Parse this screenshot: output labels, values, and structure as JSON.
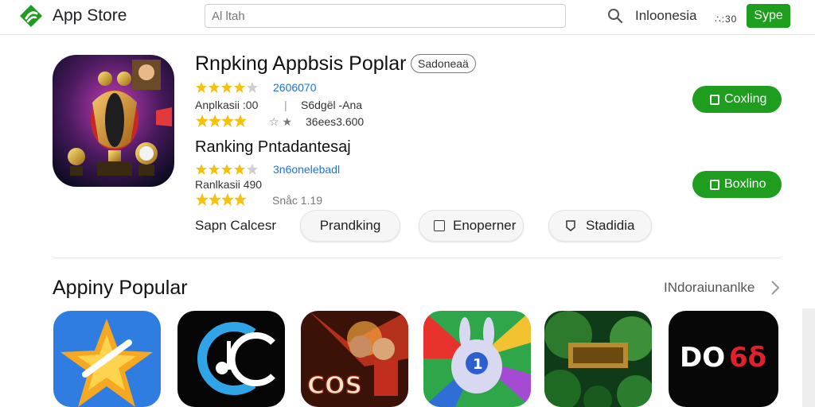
{
  "header": {
    "app_title": "App Store",
    "search_value": "Al ltah",
    "search_meta": "∴:30",
    "region": "Inloonesia",
    "sync_label": "Sype"
  },
  "ranking": {
    "title": "Rnpking Appbsis Poplar",
    "region_chip": "Sadoneaä",
    "item1": {
      "score": "2606070",
      "label": "Anplkasii :00",
      "sublabel": "S6dgël -Ana",
      "count": "36ees3.600",
      "button": "Coxling"
    },
    "subtitle": "Ranking Pntadantesaj",
    "item2": {
      "score": "3n6onelebadl",
      "label": "Ranlkasii 490",
      "count": "Snåc 1.19",
      "button": "Boxlino"
    },
    "filter_label": "Sapn Calcesr",
    "filters": [
      "Prandking",
      "Enoperner",
      "Stadidia"
    ]
  },
  "popular": {
    "title": "Appiny Popular",
    "see_more": "INdoraiunanlke",
    "apps": [
      {
        "name": "star-app",
        "text": ""
      },
      {
        "name": "music-app",
        "text": "C"
      },
      {
        "name": "action-game",
        "text": "COS"
      },
      {
        "name": "rabbit-game",
        "text": "1"
      },
      {
        "name": "jungle-game",
        "text": ""
      },
      {
        "name": "d-app",
        "text": "DO6δ"
      }
    ]
  },
  "colors": {
    "accent_green": "#1f9d1f",
    "link_blue": "#1a73e8",
    "star_gold": "#f4c20d"
  }
}
